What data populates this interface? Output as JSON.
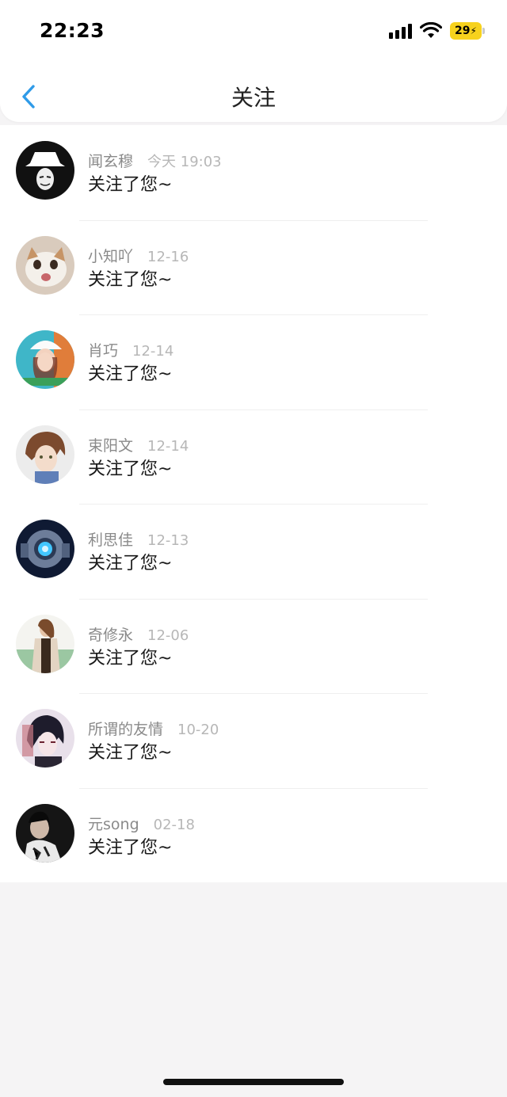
{
  "status": {
    "time": "22:23",
    "battery": "29"
  },
  "nav": {
    "title": "关注"
  },
  "items": [
    {
      "name": "闻玄穆",
      "date": "今天 19:03",
      "message": "关注了您~",
      "avatar": "mask-avatar"
    },
    {
      "name": "小知吖",
      "date": "12-16",
      "message": "关注了您~",
      "avatar": "cat-avatar"
    },
    {
      "name": "肖巧",
      "date": "12-14",
      "message": "关注了您~",
      "avatar": "girl-hat-avatar"
    },
    {
      "name": "束阳文",
      "date": "12-14",
      "message": "关注了您~",
      "avatar": "anime-boy-avatar"
    },
    {
      "name": "利思佳",
      "date": "12-13",
      "message": "关注了您~",
      "avatar": "robot-avatar"
    },
    {
      "name": "奇修永",
      "date": "12-06",
      "message": "关注了您~",
      "avatar": "woman-photo-avatar"
    },
    {
      "name": "所谓的友情",
      "date": "10-20",
      "message": "关注了您~",
      "avatar": "anime-dark-avatar"
    },
    {
      "name": "元song",
      "date": "02-18",
      "message": "关注了您~",
      "avatar": "dark-photo-avatar"
    }
  ],
  "colors": {
    "accent": "#2f9be8",
    "battery": "#f7d21d"
  }
}
